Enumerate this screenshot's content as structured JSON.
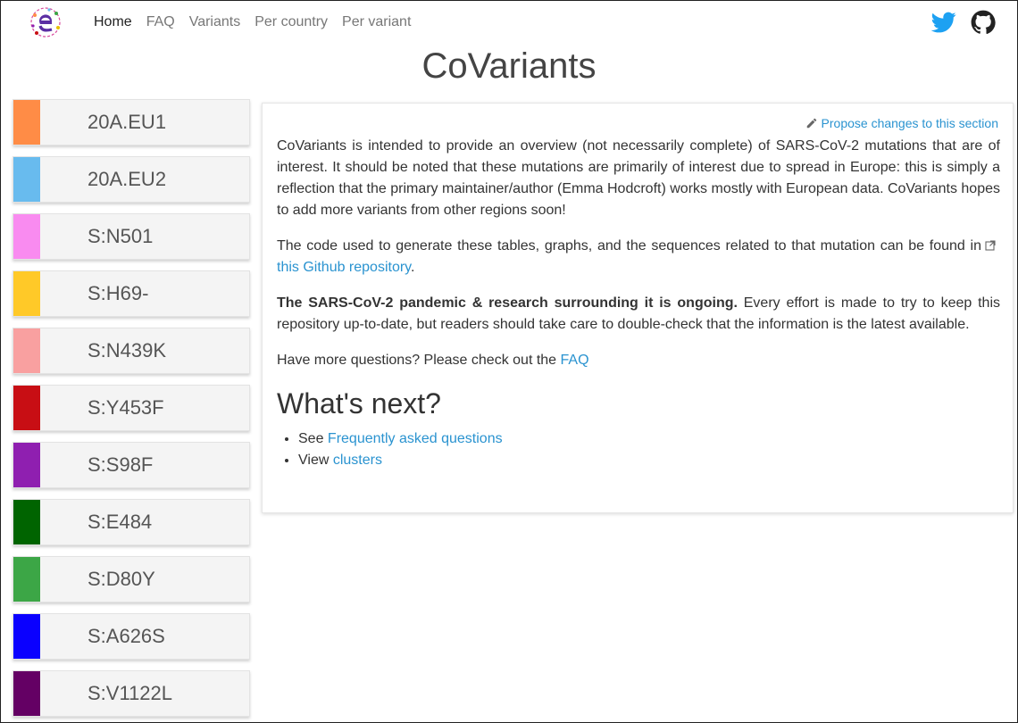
{
  "nav": {
    "logo_name": "nextstrain-e-logo",
    "links": [
      {
        "label": "Home"
      },
      {
        "label": "FAQ"
      },
      {
        "label": "Variants"
      },
      {
        "label": "Per country"
      },
      {
        "label": "Per variant"
      }
    ],
    "social": [
      "twitter-icon",
      "github-icon"
    ]
  },
  "page": {
    "title": "CoVariants"
  },
  "sidebar": {
    "variants": [
      {
        "label": "20A.EU1",
        "color": "#ff8c46"
      },
      {
        "label": "20A.EU2",
        "color": "#68bbee"
      },
      {
        "label": "S:N501",
        "color": "#f98bf0"
      },
      {
        "label": "S:H69-",
        "color": "#ffc928"
      },
      {
        "label": "S:N439K",
        "color": "#f9a0a0"
      },
      {
        "label": "S:Y453F",
        "color": "#c80e14"
      },
      {
        "label": "S:S98F",
        "color": "#8f1fb0"
      },
      {
        "label": "S:E484",
        "color": "#006400"
      },
      {
        "label": "S:D80Y",
        "color": "#3ca646"
      },
      {
        "label": "S:A626S",
        "color": "#0a00ff"
      },
      {
        "label": "S:V1122L",
        "color": "#640064"
      }
    ]
  },
  "main": {
    "propose_label": "Propose changes to this section",
    "intro": "CoVariants is intended to provide an overview (not necessarily complete) of SARS-CoV-2 mutations that are of interest. It should be noted that these mutations are primarily of interest due to spread in Europe: this is simply a reflection that the primary maintainer/author (Emma Hodcroft) works mostly with European data. CoVariants hopes to add more variants from other regions soon!",
    "code_text_before": "The code used to generate these tables, graphs, and the sequences related to that mutation can be found in",
    "code_link": "this Github repository",
    "code_text_after": ".",
    "ongoing_bold": "The SARS-CoV-2 pandemic & research surrounding it is ongoing.",
    "ongoing_rest": " Every effort is made to try to keep this repository up-to-date, but readers should take care to double-check that the information is the latest available.",
    "questions_text": "Have more questions? Please check out the ",
    "questions_link": "FAQ",
    "whats_next_heading": "What's next?",
    "next_items": [
      {
        "prefix": "See ",
        "link": "Frequently asked questions"
      },
      {
        "prefix": "View ",
        "link": "clusters"
      }
    ]
  },
  "colors": {
    "link": "#2a93d0",
    "twitter": "#1da1f2",
    "github": "#222222"
  }
}
